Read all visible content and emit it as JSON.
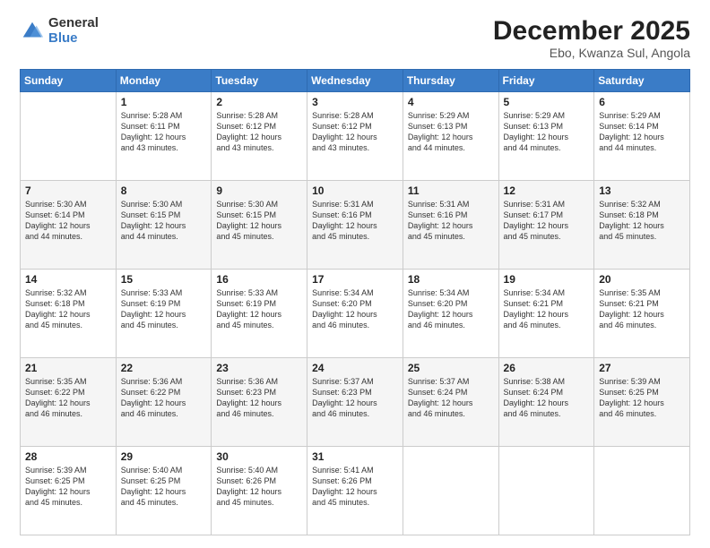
{
  "logo": {
    "general": "General",
    "blue": "Blue"
  },
  "title": "December 2025",
  "subtitle": "Ebo, Kwanza Sul, Angola",
  "weekdays": [
    "Sunday",
    "Monday",
    "Tuesday",
    "Wednesday",
    "Thursday",
    "Friday",
    "Saturday"
  ],
  "weeks": [
    [
      {
        "day": "",
        "info": ""
      },
      {
        "day": "1",
        "info": "Sunrise: 5:28 AM\nSunset: 6:11 PM\nDaylight: 12 hours\nand 43 minutes."
      },
      {
        "day": "2",
        "info": "Sunrise: 5:28 AM\nSunset: 6:12 PM\nDaylight: 12 hours\nand 43 minutes."
      },
      {
        "day": "3",
        "info": "Sunrise: 5:28 AM\nSunset: 6:12 PM\nDaylight: 12 hours\nand 43 minutes."
      },
      {
        "day": "4",
        "info": "Sunrise: 5:29 AM\nSunset: 6:13 PM\nDaylight: 12 hours\nand 44 minutes."
      },
      {
        "day": "5",
        "info": "Sunrise: 5:29 AM\nSunset: 6:13 PM\nDaylight: 12 hours\nand 44 minutes."
      },
      {
        "day": "6",
        "info": "Sunrise: 5:29 AM\nSunset: 6:14 PM\nDaylight: 12 hours\nand 44 minutes."
      }
    ],
    [
      {
        "day": "7",
        "info": "Sunrise: 5:30 AM\nSunset: 6:14 PM\nDaylight: 12 hours\nand 44 minutes."
      },
      {
        "day": "8",
        "info": "Sunrise: 5:30 AM\nSunset: 6:15 PM\nDaylight: 12 hours\nand 44 minutes."
      },
      {
        "day": "9",
        "info": "Sunrise: 5:30 AM\nSunset: 6:15 PM\nDaylight: 12 hours\nand 45 minutes."
      },
      {
        "day": "10",
        "info": "Sunrise: 5:31 AM\nSunset: 6:16 PM\nDaylight: 12 hours\nand 45 minutes."
      },
      {
        "day": "11",
        "info": "Sunrise: 5:31 AM\nSunset: 6:16 PM\nDaylight: 12 hours\nand 45 minutes."
      },
      {
        "day": "12",
        "info": "Sunrise: 5:31 AM\nSunset: 6:17 PM\nDaylight: 12 hours\nand 45 minutes."
      },
      {
        "day": "13",
        "info": "Sunrise: 5:32 AM\nSunset: 6:18 PM\nDaylight: 12 hours\nand 45 minutes."
      }
    ],
    [
      {
        "day": "14",
        "info": "Sunrise: 5:32 AM\nSunset: 6:18 PM\nDaylight: 12 hours\nand 45 minutes."
      },
      {
        "day": "15",
        "info": "Sunrise: 5:33 AM\nSunset: 6:19 PM\nDaylight: 12 hours\nand 45 minutes."
      },
      {
        "day": "16",
        "info": "Sunrise: 5:33 AM\nSunset: 6:19 PM\nDaylight: 12 hours\nand 45 minutes."
      },
      {
        "day": "17",
        "info": "Sunrise: 5:34 AM\nSunset: 6:20 PM\nDaylight: 12 hours\nand 46 minutes."
      },
      {
        "day": "18",
        "info": "Sunrise: 5:34 AM\nSunset: 6:20 PM\nDaylight: 12 hours\nand 46 minutes."
      },
      {
        "day": "19",
        "info": "Sunrise: 5:34 AM\nSunset: 6:21 PM\nDaylight: 12 hours\nand 46 minutes."
      },
      {
        "day": "20",
        "info": "Sunrise: 5:35 AM\nSunset: 6:21 PM\nDaylight: 12 hours\nand 46 minutes."
      }
    ],
    [
      {
        "day": "21",
        "info": "Sunrise: 5:35 AM\nSunset: 6:22 PM\nDaylight: 12 hours\nand 46 minutes."
      },
      {
        "day": "22",
        "info": "Sunrise: 5:36 AM\nSunset: 6:22 PM\nDaylight: 12 hours\nand 46 minutes."
      },
      {
        "day": "23",
        "info": "Sunrise: 5:36 AM\nSunset: 6:23 PM\nDaylight: 12 hours\nand 46 minutes."
      },
      {
        "day": "24",
        "info": "Sunrise: 5:37 AM\nSunset: 6:23 PM\nDaylight: 12 hours\nand 46 minutes."
      },
      {
        "day": "25",
        "info": "Sunrise: 5:37 AM\nSunset: 6:24 PM\nDaylight: 12 hours\nand 46 minutes."
      },
      {
        "day": "26",
        "info": "Sunrise: 5:38 AM\nSunset: 6:24 PM\nDaylight: 12 hours\nand 46 minutes."
      },
      {
        "day": "27",
        "info": "Sunrise: 5:39 AM\nSunset: 6:25 PM\nDaylight: 12 hours\nand 46 minutes."
      }
    ],
    [
      {
        "day": "28",
        "info": "Sunrise: 5:39 AM\nSunset: 6:25 PM\nDaylight: 12 hours\nand 45 minutes."
      },
      {
        "day": "29",
        "info": "Sunrise: 5:40 AM\nSunset: 6:25 PM\nDaylight: 12 hours\nand 45 minutes."
      },
      {
        "day": "30",
        "info": "Sunrise: 5:40 AM\nSunset: 6:26 PM\nDaylight: 12 hours\nand 45 minutes."
      },
      {
        "day": "31",
        "info": "Sunrise: 5:41 AM\nSunset: 6:26 PM\nDaylight: 12 hours\nand 45 minutes."
      },
      {
        "day": "",
        "info": ""
      },
      {
        "day": "",
        "info": ""
      },
      {
        "day": "",
        "info": ""
      }
    ]
  ]
}
